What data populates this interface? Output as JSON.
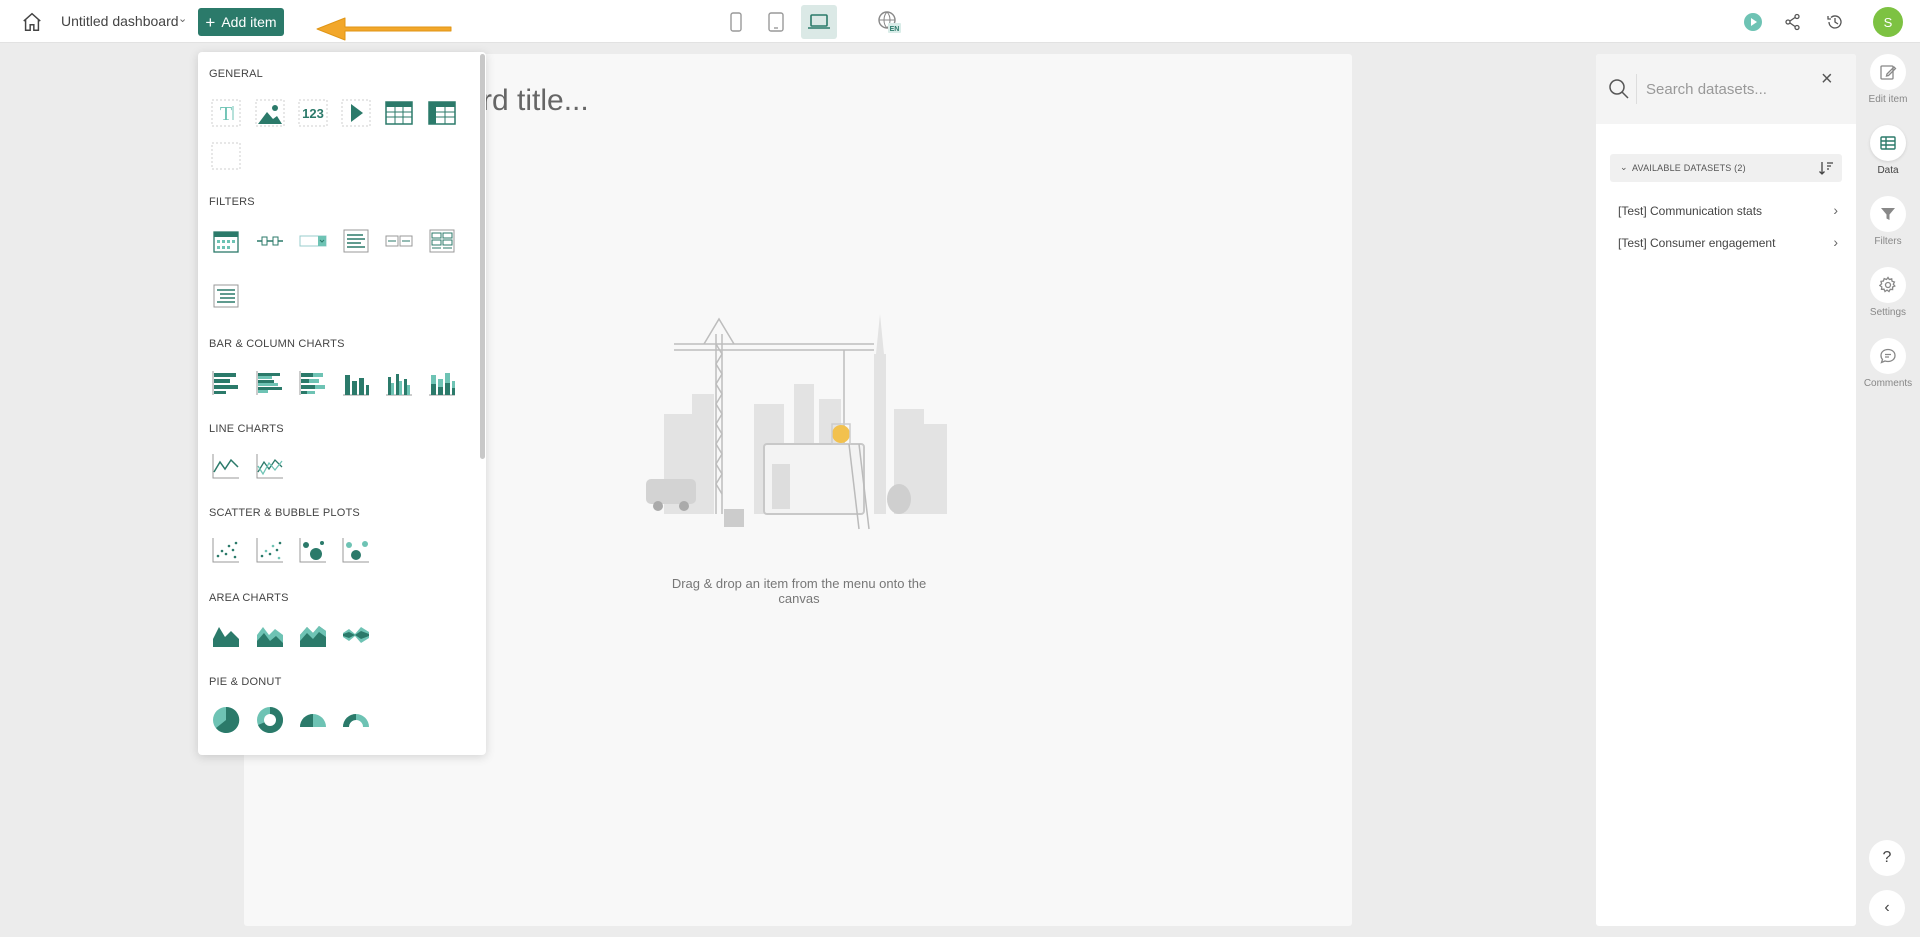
{
  "topbar": {
    "dashboard_title": "Untitled dashboard",
    "add_item_label": "Add item",
    "lang_code": "EN",
    "avatar_initial": "S"
  },
  "canvas": {
    "title_placeholder": "rd title...",
    "drop_hint": "Drag & drop an item from the menu onto the canvas"
  },
  "add_panel": {
    "sections": [
      "GENERAL",
      "FILTERS",
      "BAR & COLUMN CHARTS",
      "LINE CHARTS",
      "SCATTER & BUBBLE PLOTS",
      "AREA CHARTS",
      "PIE & DONUT"
    ],
    "number_tile_text": "123"
  },
  "data_panel": {
    "search_placeholder": "Search datasets...",
    "available_label": "AVAILABLE DATASETS",
    "available_count": "(2)",
    "datasets": [
      "[Test] Communication stats",
      "[Test] Consumer engagement"
    ]
  },
  "rail": {
    "items": [
      {
        "label": "Edit item",
        "icon": "edit-icon"
      },
      {
        "label": "Data",
        "icon": "table-icon"
      },
      {
        "label": "Filters",
        "icon": "filter-icon"
      },
      {
        "label": "Settings",
        "icon": "gear-icon"
      },
      {
        "label": "Comments",
        "icon": "comment-icon"
      }
    ],
    "help_label": "?",
    "collapse_label": "‹"
  },
  "colors": {
    "accent": "#2b7a6a",
    "accent_light": "#6ec3b4",
    "arrow": "#f2a72a",
    "avatar": "#7dc242"
  }
}
